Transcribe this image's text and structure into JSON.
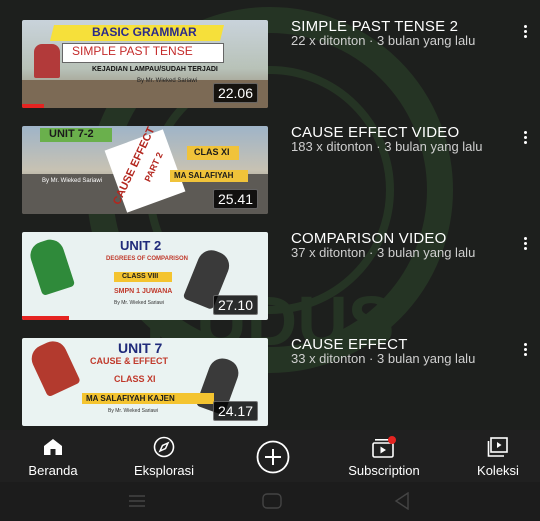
{
  "videos": [
    {
      "title": "SIMPLE PAST TENSE 2",
      "meta": "22 x ditonton · 3 bulan yang lalu",
      "duration": "22.06",
      "progress": 0.09,
      "thumb": {
        "banner": "BASIC GRAMMAR",
        "heading": "SIMPLE PAST TENSE",
        "sub": "KEJADIAN LAMPAU/SUDAH TERJADI",
        "by": "By Mr. Wieked Sariawi"
      }
    },
    {
      "title": "CAUSE EFFECT VIDEO",
      "meta": "183 x ditonton · 3 bulan yang lalu",
      "duration": "25.41",
      "progress": 0,
      "thumb": {
        "unit": "UNIT 7-2",
        "diagonal": "CAUSE EFFECT",
        "part": "PART 2",
        "klass": "CLAS XI",
        "school": "MA SALAFIYAH",
        "by": "By Mr. Wieked Sariawi"
      }
    },
    {
      "title": "COMPARISON VIDEO",
      "meta": "37 x ditonton · 3 bulan yang lalu",
      "duration": "27.10",
      "progress": 0.19,
      "thumb": {
        "unit": "UNIT 2",
        "topic": "DEGREES OF COMPARISON",
        "klass": "CLASS VIII",
        "school": "SMPN 1 JUWANA",
        "by": "By Mr. Wieked Sariawi"
      }
    },
    {
      "title": "CAUSE EFFECT",
      "meta": "33 x ditonton · 3 bulan yang lalu",
      "duration": "24.17",
      "progress": 0,
      "thumb": {
        "unit": "UNIT 7",
        "topic": "CAUSE & EFFECT",
        "klass": "CLASS XI",
        "school": "MA SALAFIYAH KAJEN",
        "by": "By Mr. Wieked Sariawi"
      }
    }
  ],
  "nav": {
    "home_label": "Beranda",
    "explore_label": "Eksplorasi",
    "subscription_label": "Subscription",
    "library_label": "Koleksi"
  },
  "colors": {
    "accent": "#e52421",
    "background": "#1d1f1d",
    "watermark": "#3c6a36"
  },
  "icons": {
    "home": "home-icon",
    "explore": "compass-icon",
    "create": "plus-circle-icon",
    "subscription": "subscription-icon",
    "library": "library-icon"
  }
}
